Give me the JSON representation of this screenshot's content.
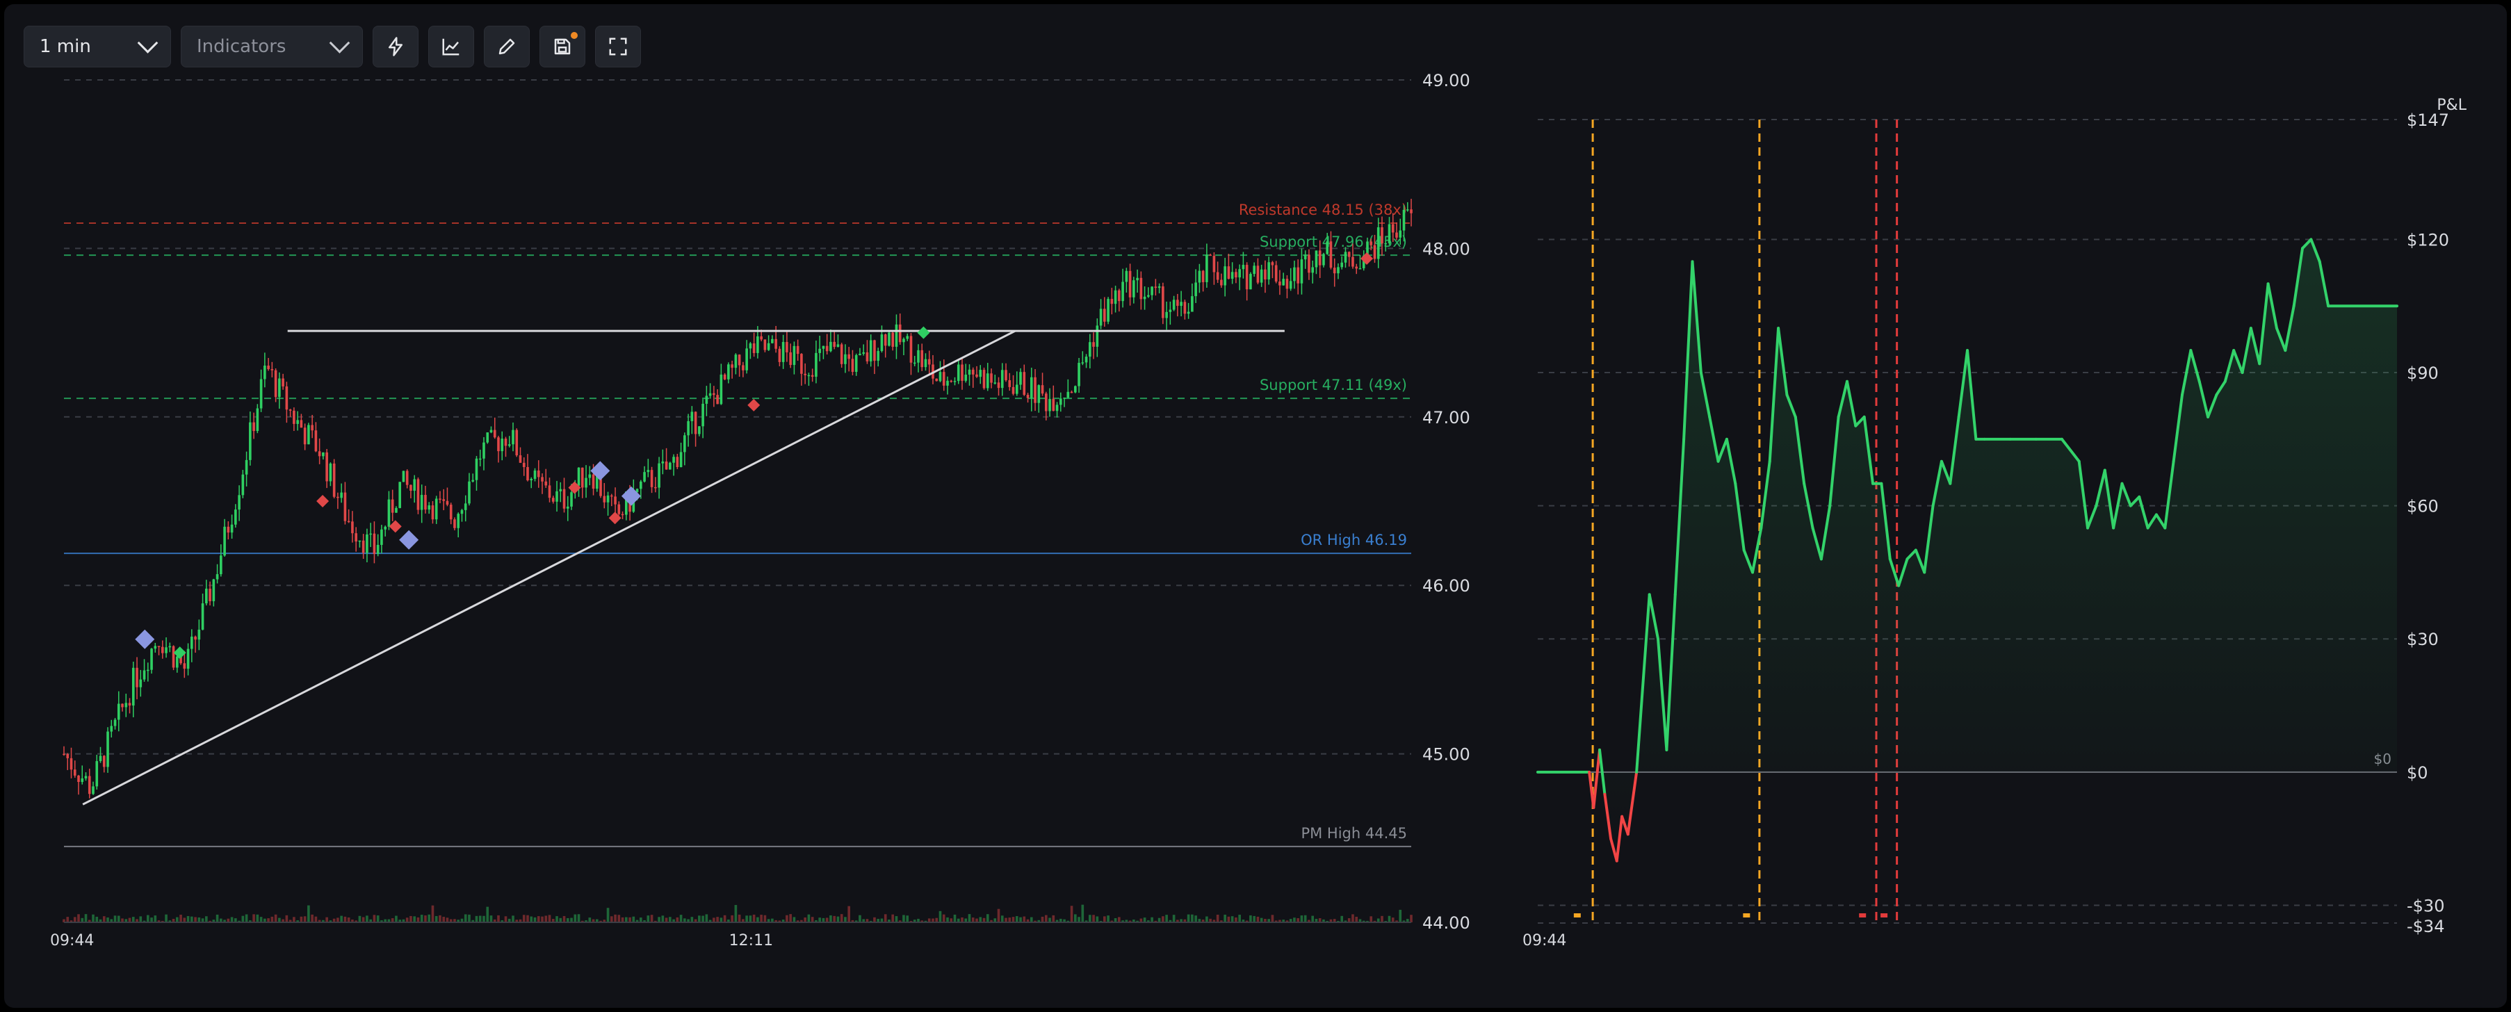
{
  "toolbar": {
    "interval": "1 min",
    "indicators_placeholder": "Indicators",
    "buttons": [
      "lightning-icon",
      "chart-line-icon",
      "pencil-icon",
      "save-icon",
      "fullscreen-icon"
    ]
  },
  "colors": {
    "background": "#111217",
    "up": "#2fcf62",
    "down": "#e04848",
    "resistance": "#c0392b",
    "support": "#27ae60",
    "or_high": "#3a7fd0",
    "pm_high": "#8a8d95",
    "trendline": "#d8d8dc",
    "pnl_positive": "#33d36a",
    "pnl_negative": "#f24545",
    "entry_marker": "#f5a623",
    "exit_marker": "#e23b3b"
  },
  "chart_data": [
    {
      "type": "candlestick",
      "x_ticks": [
        "09:44",
        "12:11"
      ],
      "y_ticks": [
        "49.00",
        "48.00",
        "47.00",
        "46.00",
        "45.00",
        "44.00"
      ],
      "ylim": [
        44.0,
        49.0
      ],
      "levels": [
        {
          "label": "Resistance 48.15 (38x)",
          "value": 48.15,
          "kind": "resistance"
        },
        {
          "label": "Support 47.96 (45x)",
          "value": 47.96,
          "kind": "support"
        },
        {
          "label": "Support 47.11 (49x)",
          "value": 47.11,
          "kind": "support"
        },
        {
          "label": "OR High 46.19",
          "value": 46.19,
          "kind": "or_high"
        },
        {
          "label": "PM High 44.45",
          "value": 44.45,
          "kind": "pm_high"
        }
      ],
      "price_path": [
        [
          0,
          45.0
        ],
        [
          0.02,
          44.8
        ],
        [
          0.05,
          45.4
        ],
        [
          0.07,
          45.7
        ],
        [
          0.09,
          45.5
        ],
        [
          0.11,
          46.0
        ],
        [
          0.13,
          46.6
        ],
        [
          0.15,
          47.3
        ],
        [
          0.17,
          47.0
        ],
        [
          0.19,
          46.8
        ],
        [
          0.21,
          46.4
        ],
        [
          0.23,
          46.2
        ],
        [
          0.25,
          46.6
        ],
        [
          0.27,
          46.5
        ],
        [
          0.29,
          46.4
        ],
        [
          0.31,
          46.8
        ],
        [
          0.33,
          46.9
        ],
        [
          0.35,
          46.6
        ],
        [
          0.37,
          46.5
        ],
        [
          0.39,
          46.7
        ],
        [
          0.41,
          46.4
        ],
        [
          0.43,
          46.6
        ],
        [
          0.45,
          46.7
        ],
        [
          0.47,
          47.0
        ],
        [
          0.49,
          47.2
        ],
        [
          0.51,
          47.4
        ],
        [
          0.53,
          47.4
        ],
        [
          0.55,
          47.3
        ],
        [
          0.57,
          47.4
        ],
        [
          0.59,
          47.3
        ],
        [
          0.61,
          47.5
        ],
        [
          0.63,
          47.4
        ],
        [
          0.65,
          47.2
        ],
        [
          0.67,
          47.3
        ],
        [
          0.69,
          47.2
        ],
        [
          0.71,
          47.2
        ],
        [
          0.73,
          47.1
        ],
        [
          0.75,
          47.2
        ],
        [
          0.77,
          47.6
        ],
        [
          0.79,
          47.8
        ],
        [
          0.81,
          47.7
        ],
        [
          0.83,
          47.6
        ],
        [
          0.85,
          47.9
        ],
        [
          0.87,
          47.8
        ],
        [
          0.89,
          47.9
        ],
        [
          0.91,
          47.8
        ],
        [
          0.93,
          48.0
        ],
        [
          0.95,
          47.9
        ],
        [
          0.97,
          48.0
        ],
        [
          1.0,
          48.2
        ]
      ],
      "markers": [
        {
          "t": 0.06,
          "price": 45.68,
          "kind": "diamond-blue"
        },
        {
          "t": 0.086,
          "price": 45.6,
          "kind": "diamond-green"
        },
        {
          "t": 0.192,
          "price": 46.5,
          "kind": "diamond-red"
        },
        {
          "t": 0.246,
          "price": 46.35,
          "kind": "diamond-red"
        },
        {
          "t": 0.256,
          "price": 46.27,
          "kind": "diamond-blue"
        },
        {
          "t": 0.379,
          "price": 46.58,
          "kind": "diamond-red"
        },
        {
          "t": 0.398,
          "price": 46.68,
          "kind": "diamond-blue"
        },
        {
          "t": 0.409,
          "price": 46.4,
          "kind": "diamond-red"
        },
        {
          "t": 0.421,
          "price": 46.53,
          "kind": "diamond-blue"
        },
        {
          "t": 0.512,
          "price": 47.07,
          "kind": "diamond-red"
        },
        {
          "t": 0.638,
          "price": 47.5,
          "kind": "diamond-green"
        },
        {
          "t": 0.967,
          "price": 47.94,
          "kind": "diamond-red"
        }
      ],
      "trendlines": [
        {
          "t1": 0.014,
          "p1": 44.7,
          "t2": 0.706,
          "p2": 47.51
        },
        {
          "t1": 0.166,
          "p1": 47.51,
          "t2": 0.906,
          "p2": 47.51
        }
      ]
    },
    {
      "type": "line",
      "title": "P&L",
      "x_ticks": [
        "09:44"
      ],
      "y_ticks": [
        "$147",
        "$120",
        "$90",
        "$60",
        "$30",
        "$0",
        "-$30",
        "-$34"
      ],
      "ylim": [
        -34,
        147
      ],
      "zero_label": "$0",
      "values": [
        [
          0,
          0
        ],
        [
          0.06,
          0
        ],
        [
          0.065,
          -8
        ],
        [
          0.072,
          5
        ],
        [
          0.078,
          -5
        ],
        [
          0.085,
          -15
        ],
        [
          0.092,
          -20
        ],
        [
          0.098,
          -10
        ],
        [
          0.105,
          -14
        ],
        [
          0.115,
          0
        ],
        [
          0.13,
          40
        ],
        [
          0.14,
          30
        ],
        [
          0.15,
          5
        ],
        [
          0.16,
          40
        ],
        [
          0.17,
          75
        ],
        [
          0.18,
          115
        ],
        [
          0.19,
          90
        ],
        [
          0.2,
          80
        ],
        [
          0.21,
          70
        ],
        [
          0.22,
          75
        ],
        [
          0.23,
          65
        ],
        [
          0.24,
          50
        ],
        [
          0.25,
          45
        ],
        [
          0.26,
          55
        ],
        [
          0.27,
          70
        ],
        [
          0.28,
          100
        ],
        [
          0.29,
          85
        ],
        [
          0.3,
          80
        ],
        [
          0.31,
          65
        ],
        [
          0.32,
          55
        ],
        [
          0.33,
          48
        ],
        [
          0.34,
          60
        ],
        [
          0.35,
          80
        ],
        [
          0.36,
          88
        ],
        [
          0.37,
          78
        ],
        [
          0.38,
          80
        ],
        [
          0.39,
          65
        ],
        [
          0.4,
          65
        ],
        [
          0.41,
          48
        ],
        [
          0.42,
          42
        ],
        [
          0.43,
          48
        ],
        [
          0.44,
          50
        ],
        [
          0.45,
          45
        ],
        [
          0.46,
          60
        ],
        [
          0.47,
          70
        ],
        [
          0.48,
          65
        ],
        [
          0.49,
          80
        ],
        [
          0.5,
          95
        ],
        [
          0.51,
          75
        ],
        [
          0.52,
          75
        ],
        [
          0.55,
          75
        ],
        [
          0.58,
          75
        ],
        [
          0.61,
          75
        ],
        [
          0.63,
          70
        ],
        [
          0.64,
          55
        ],
        [
          0.65,
          60
        ],
        [
          0.66,
          68
        ],
        [
          0.67,
          55
        ],
        [
          0.68,
          65
        ],
        [
          0.69,
          60
        ],
        [
          0.7,
          62
        ],
        [
          0.71,
          55
        ],
        [
          0.72,
          58
        ],
        [
          0.73,
          55
        ],
        [
          0.74,
          70
        ],
        [
          0.75,
          85
        ],
        [
          0.76,
          95
        ],
        [
          0.77,
          88
        ],
        [
          0.78,
          80
        ],
        [
          0.79,
          85
        ],
        [
          0.8,
          88
        ],
        [
          0.81,
          95
        ],
        [
          0.82,
          90
        ],
        [
          0.83,
          100
        ],
        [
          0.84,
          92
        ],
        [
          0.85,
          110
        ],
        [
          0.86,
          100
        ],
        [
          0.87,
          95
        ],
        [
          0.88,
          105
        ],
        [
          0.89,
          118
        ],
        [
          0.9,
          120
        ],
        [
          0.91,
          115
        ],
        [
          0.92,
          105
        ],
        [
          1.0,
          105
        ]
      ],
      "entry_lines": [
        0.064,
        0.258
      ],
      "exit_lines": [
        0.394,
        0.418
      ],
      "entry_marks": [
        0.046,
        0.243
      ],
      "exit_marks": [
        0.378,
        0.403
      ]
    }
  ]
}
